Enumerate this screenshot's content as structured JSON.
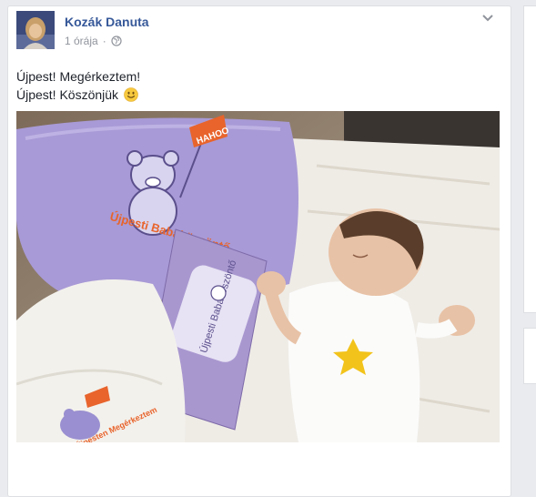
{
  "post": {
    "author": "Kozák Danuta",
    "time": "1 órája",
    "separator": "·",
    "lines": [
      "Újpest! Megérkeztem!",
      "Újpest! Köszönjük"
    ]
  },
  "icons": {
    "audience": "globe-icon",
    "menu": "chevron-down-icon",
    "smiley": "smiley-emoji-icon"
  },
  "photo": {
    "pillow_text": "Újpesti Babaköszöntő",
    "flag_text": "HAHOO",
    "card_text": "Újpesti Babaköszöntő",
    "onesie_text": "Újpesten Megérkeztem"
  },
  "colors": {
    "link": "#365899",
    "meta": "#90949c",
    "text": "#1d2129",
    "background": "#e9ebee"
  }
}
